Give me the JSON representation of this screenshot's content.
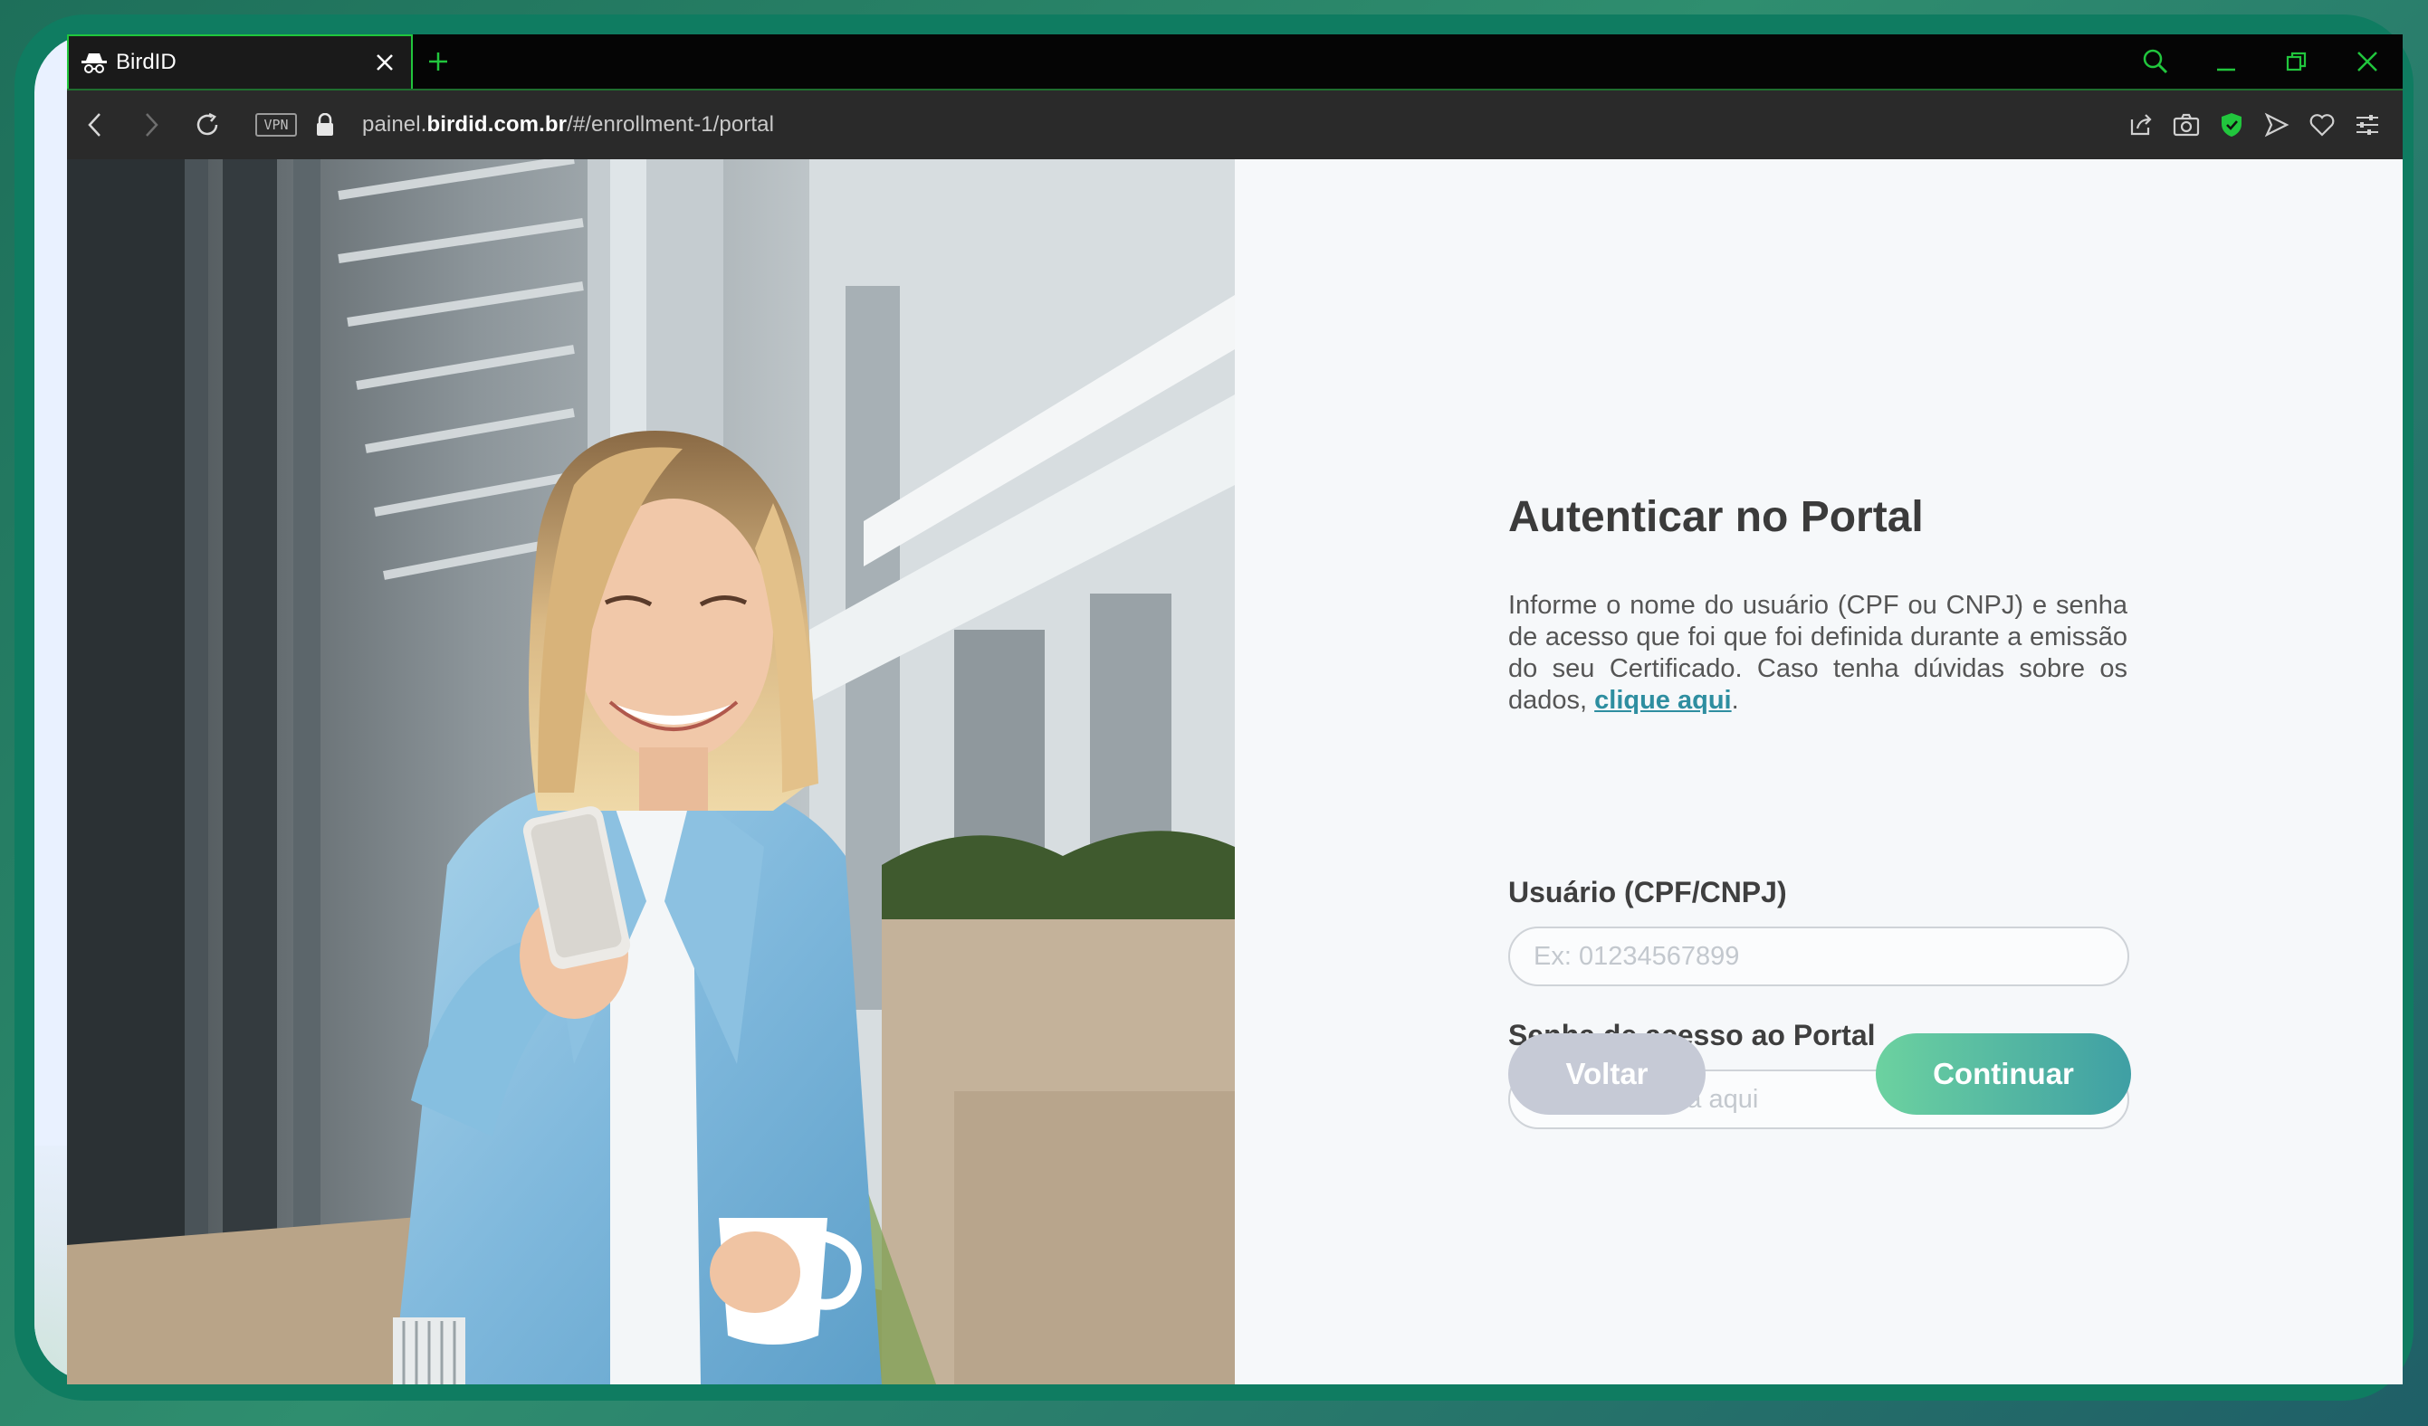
{
  "browser": {
    "tab_title": "BirdID",
    "vpn_label": "VPN",
    "url_prefix": "painel.",
    "url_domain": "birdid.com.br",
    "url_path": "/#/enrollment-1/portal",
    "accent_color": "#21c63d"
  },
  "icons": {
    "tab": "incognito-icon",
    "tab_close": "close-icon",
    "new_tab": "plus-icon",
    "search": "search-icon",
    "minimize": "minimize-icon",
    "restore": "restore-icon",
    "close_window": "close-icon",
    "back": "chevron-left-icon",
    "forward": "chevron-right-icon",
    "reload": "reload-icon",
    "lock": "lock-icon",
    "share": "share-icon",
    "snapshot": "camera-icon",
    "shield": "shield-icon",
    "send": "send-icon",
    "favorite": "heart-icon",
    "settings": "sliders-icon",
    "password_toggle": "eye-icon"
  },
  "page": {
    "title": "Autenticar no Portal",
    "description": "Informe o nome do usuário (CPF ou CNPJ) e senha de acesso que foi que foi definida durante a emissão do seu Certificado. Caso tenha dúvidas sobre os dados, ",
    "help_link": "clique aqui",
    "description_end": ".",
    "user_label": "Usuário (CPF/CNPJ)",
    "user_placeholder": "Ex: 01234567899",
    "user_value": "",
    "password_label": "Senha de acesso ao Portal",
    "password_placeholder": "Digite a senha aqui",
    "password_value": "",
    "back_button": "Voltar",
    "continue_button": "Continuar"
  },
  "colors": {
    "link": "#2e8ea0",
    "continue_start": "#6cd2a0",
    "continue_end": "#3f9fa4",
    "back_button": "#c6cad6"
  }
}
